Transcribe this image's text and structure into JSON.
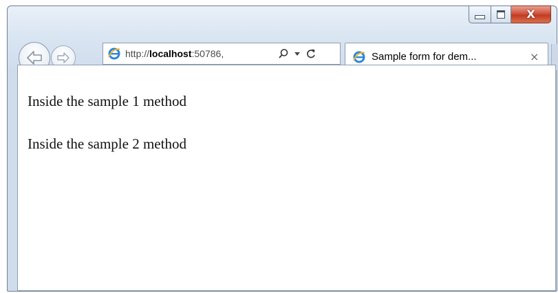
{
  "window": {
    "caption_buttons": {
      "minimize_icon": "minimize-icon",
      "maximize_icon": "maximize-icon",
      "close_glyph": "X"
    },
    "close_color": "#c9452c",
    "frame_color": "#dbe6f3"
  },
  "navigation": {
    "back_icon": "back-arrow-icon",
    "forward_icon": "forward-arrow-icon"
  },
  "address_bar": {
    "url_prefix": "http://",
    "url_host": "localhost",
    "url_suffix": ":50786,",
    "search_icon": "search-icon",
    "dropdown_icon": "chevron-down-icon",
    "refresh_icon": "refresh-icon"
  },
  "tab": {
    "title": "Sample form for dem...",
    "close_label": "×",
    "icon": "ie-icon"
  },
  "content": {
    "lines": [
      "Inside the sample 1 method",
      "Inside the sample 2 method"
    ]
  }
}
